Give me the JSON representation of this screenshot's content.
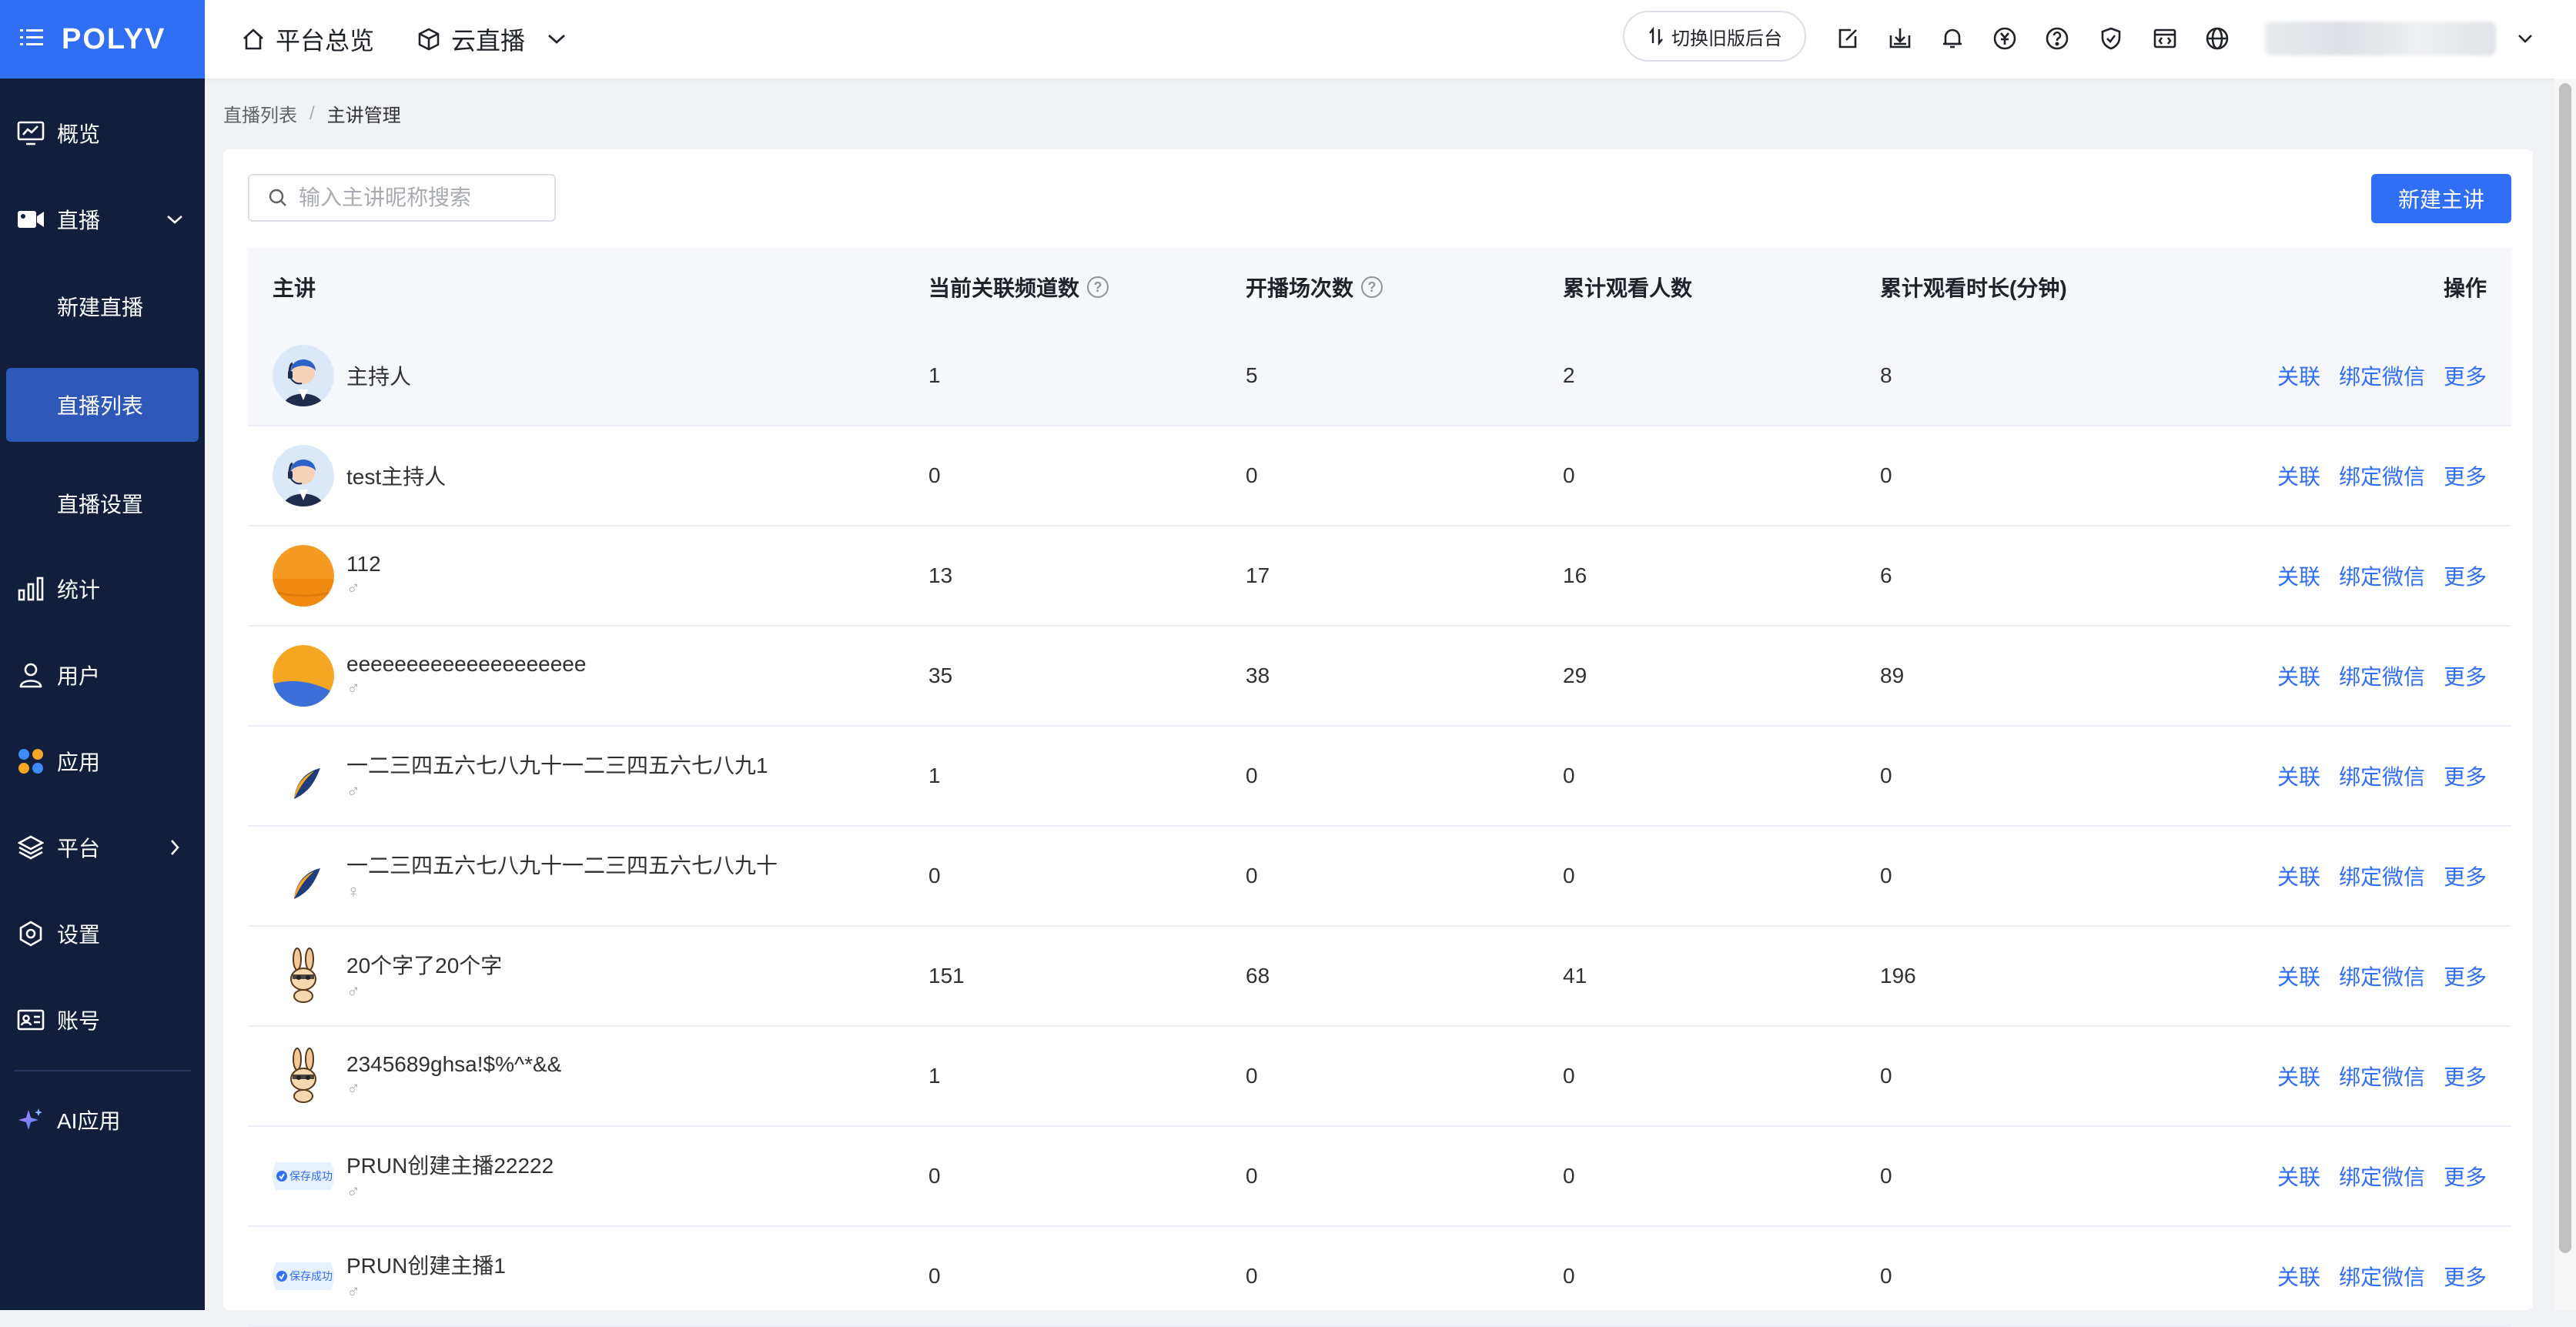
{
  "app": {
    "logo": "POLYV"
  },
  "sidebar": {
    "items": [
      {
        "label": "概览",
        "icon": "chart-monitor-icon"
      },
      {
        "label": "直播",
        "icon": "video-camera-icon"
      },
      {
        "label": "统计",
        "icon": "bar-chart-icon"
      },
      {
        "label": "用户",
        "icon": "user-icon"
      },
      {
        "label": "应用",
        "icon": "apps-grid-icon"
      },
      {
        "label": "平台",
        "icon": "layers-icon"
      },
      {
        "label": "设置",
        "icon": "gear-icon"
      },
      {
        "label": "账号",
        "icon": "id-card-icon"
      },
      {
        "label": "AI应用",
        "icon": "sparkle-icon"
      }
    ],
    "live_sub": [
      "新建直播",
      "直播列表",
      "直播设置"
    ]
  },
  "header": {
    "overview": "平台总览",
    "product": "云直播",
    "switch_label": "切换旧版后台"
  },
  "breadcrumb": {
    "parent": "直播列表",
    "separator": "/",
    "current": "主讲管理"
  },
  "search": {
    "placeholder": "输入主讲昵称搜索",
    "value": ""
  },
  "new_button": "新建主讲",
  "table": {
    "columns": [
      "主讲",
      "当前关联频道数",
      "开播场次数",
      "累计观看人数",
      "累计观看时长(分钟)",
      "操作"
    ],
    "actions": [
      "关联",
      "绑定微信",
      "更多"
    ],
    "rows": [
      {
        "name": "主持人",
        "gender": "",
        "avatar": "host",
        "channels": "1",
        "sessions": "5",
        "viewers": "2",
        "minutes": "8"
      },
      {
        "name": "test主持人",
        "gender": "",
        "avatar": "host",
        "channels": "0",
        "sessions": "0",
        "viewers": "0",
        "minutes": "0"
      },
      {
        "name": "112",
        "gender": "♂",
        "avatar": "orange",
        "channels": "13",
        "sessions": "17",
        "viewers": "16",
        "minutes": "6"
      },
      {
        "name": "eeeeeeeeeeeeeeeeeeee",
        "gender": "♂",
        "avatar": "orange-blue",
        "channels": "35",
        "sessions": "38",
        "viewers": "29",
        "minutes": "89"
      },
      {
        "name": "一二三四五六七八九十一二三四五六七八九1",
        "gender": "♂",
        "avatar": "leaf",
        "channels": "1",
        "sessions": "0",
        "viewers": "0",
        "minutes": "0"
      },
      {
        "name": "一二三四五六七八九十一二三四五六七八九十",
        "gender": "♀",
        "avatar": "leaf",
        "channels": "0",
        "sessions": "0",
        "viewers": "0",
        "minutes": "0"
      },
      {
        "name": "20个字了20个字",
        "gender": "♂",
        "avatar": "rabbit",
        "channels": "151",
        "sessions": "68",
        "viewers": "41",
        "minutes": "196"
      },
      {
        "name": "2345689ghsa!$%^*&&",
        "gender": "♂",
        "avatar": "rabbit",
        "channels": "1",
        "sessions": "0",
        "viewers": "0",
        "minutes": "0"
      },
      {
        "name": "PRUN创建主播22222",
        "gender": "♂",
        "avatar": "badge",
        "badge_text": "保存成功",
        "channels": "0",
        "sessions": "0",
        "viewers": "0",
        "minutes": "0"
      },
      {
        "name": "PRUN创建主播1",
        "gender": "♂",
        "avatar": "badge",
        "badge_text": "保存成功",
        "channels": "0",
        "sessions": "0",
        "viewers": "0",
        "minutes": "0"
      }
    ]
  },
  "colors": {
    "sidebar_bg": "#111f3d",
    "brand": "#2f6ef5",
    "active_item": "#2d58b8",
    "link": "#2f6ef5"
  }
}
